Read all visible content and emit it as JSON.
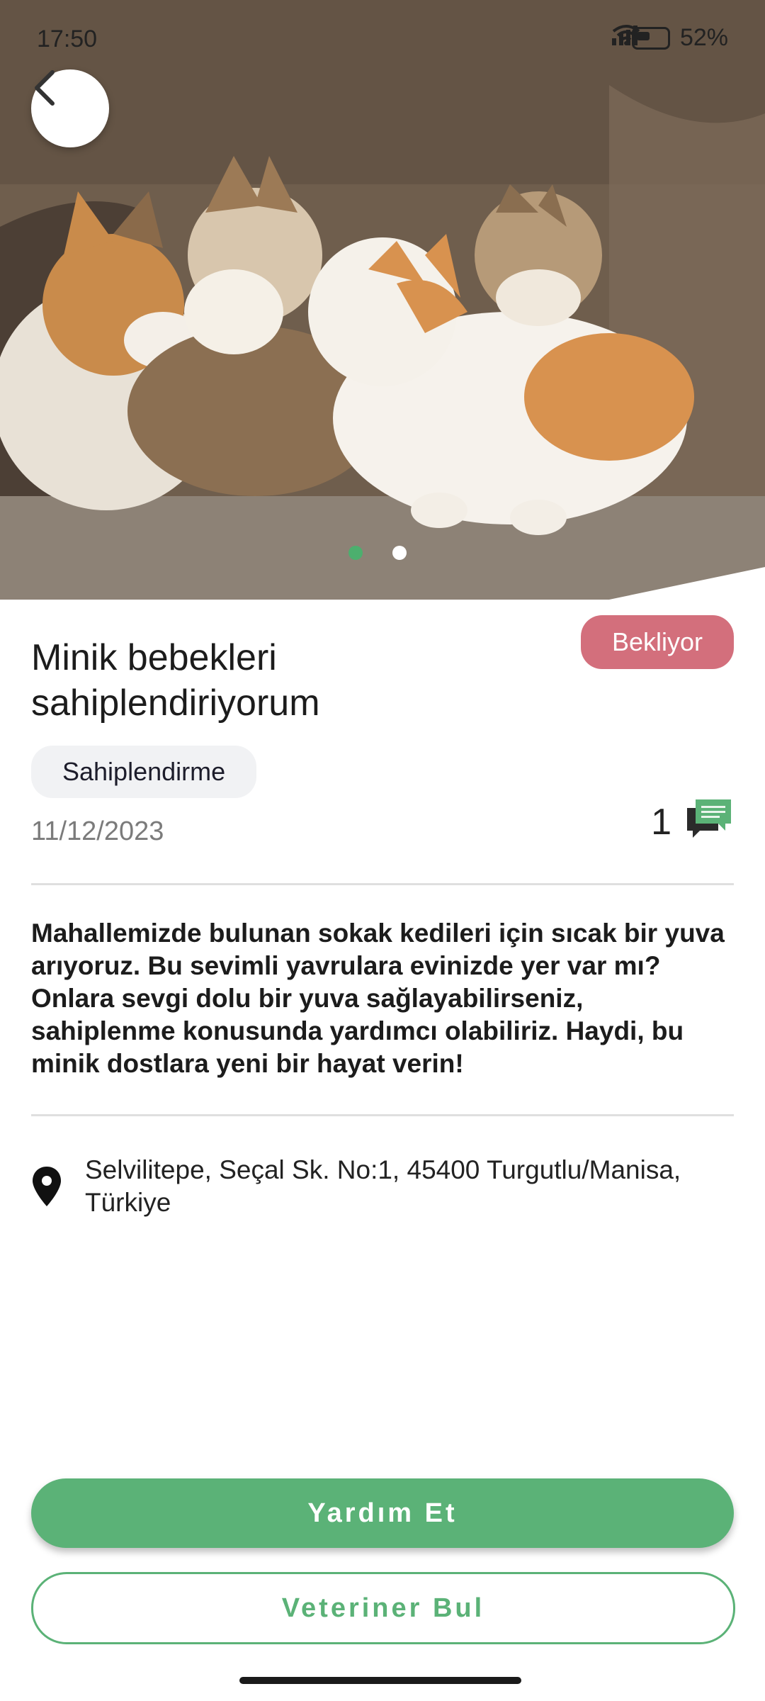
{
  "status_bar": {
    "time": "17:50",
    "battery": "52%"
  },
  "hero": {
    "image": "kittens-photo",
    "slide_count": 2,
    "active_slide": 1
  },
  "post": {
    "title": "Minik bebekleri sahiplendiriyorum",
    "status": "Bekliyor",
    "category": "Sahiplendirme",
    "date": "11/12/2023",
    "comment_count": "1",
    "description": "Mahallemizde bulunan sokak kedileri için sıcak bir yuva arıyoruz. Bu sevimli yavrulara evinizde yer var mı? Onlara sevgi dolu bir yuva sağlayabilirseniz, sahiplenme konusunda yardımcı olabiliriz. Haydi, bu minik dostlara yeni bir hayat verin!",
    "address": "Selvilitepe, Seçal Sk. No:1, 45400 Turgutlu/Manisa, Türkiye"
  },
  "actions": {
    "help_label": "Yardım Et",
    "vet_label": "Veteriner Bul"
  },
  "colors": {
    "accent": "#5bb277",
    "status_badge": "#d36f7c",
    "chip_bg": "#f1f2f4"
  },
  "icons": {
    "back": "chevron-left-icon",
    "comment": "chat-bubble-icon",
    "location": "map-pin-icon"
  }
}
